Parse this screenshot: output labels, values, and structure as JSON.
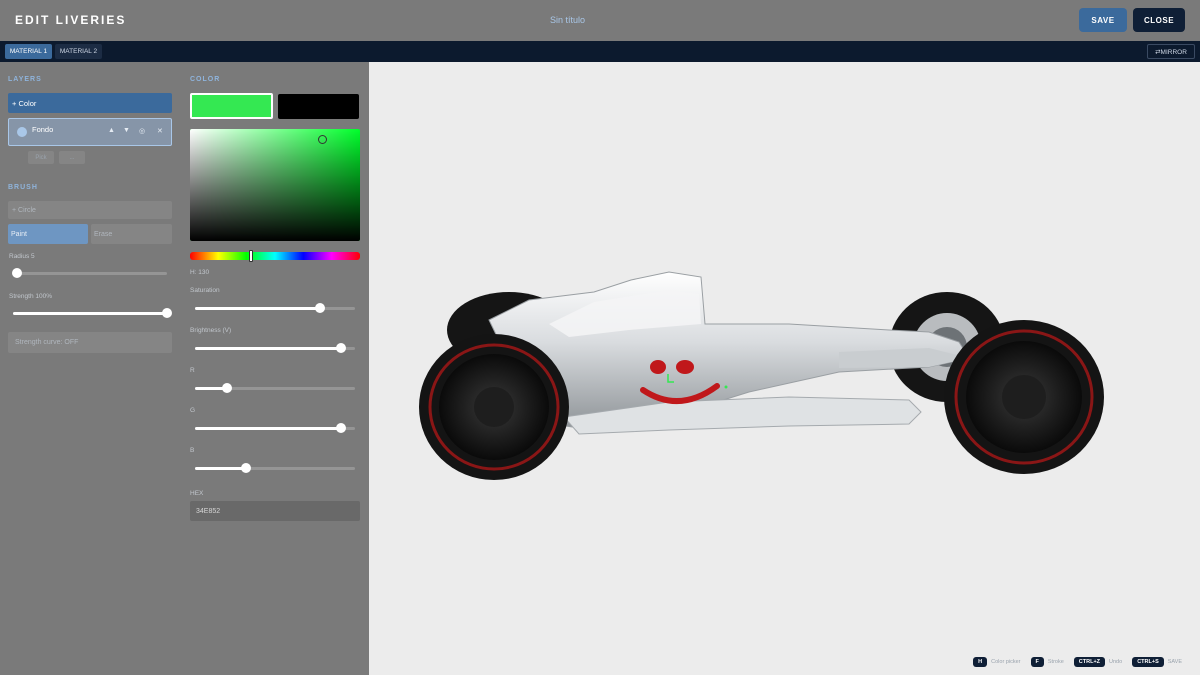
{
  "header": {
    "app_title": "EDIT LIVERIES",
    "doc_title": "Sin título",
    "save_label": "SAVE",
    "close_label": "CLOSE"
  },
  "materials": {
    "tabs": [
      {
        "label": "MATERIAL 1",
        "active": true
      },
      {
        "label": "MATERIAL 2",
        "active": false
      }
    ],
    "mirror_label": "⇄MIRROR"
  },
  "layers": {
    "section_label": "LAYERS",
    "add_color_label": "+ Color",
    "items": [
      {
        "name": "Fondo",
        "selected": true
      }
    ],
    "controls": {
      "up": "▲",
      "down": "▼",
      "visibility": "◎",
      "delete": "✕"
    },
    "actions": [
      "Pick",
      "..."
    ]
  },
  "brush": {
    "section_label": "BRUSH",
    "shape_label": "+ Circle",
    "mode_paint": "Paint",
    "mode_erase": "Erase",
    "active_mode": "Paint",
    "radius_label": "Radius 5",
    "radius_value": 0.0,
    "strength_label": "Strength 100%",
    "strength_value": 1.0,
    "strength_curve_label": "Strength curve: OFF"
  },
  "color": {
    "section_label": "COLOR",
    "primary_hex": "#34E852",
    "secondary_hex": "#000000",
    "hue_label": "H: 130",
    "hue_value": 130,
    "saturation_label": "Saturation",
    "saturation_value": 0.78,
    "brightness_label": "Brightness (V)",
    "brightness_value": 0.91,
    "r_label": "R",
    "r_value": 0.2,
    "g_label": "G",
    "g_value": 0.91,
    "b_label": "B",
    "b_value": 0.32,
    "hex_label": "HEX",
    "hex_value": "34E852"
  },
  "shortcuts": [
    {
      "key": "H",
      "label": "Color picker"
    },
    {
      "key": "F",
      "label": "Stroke"
    },
    {
      "key": "CTRL+Z",
      "label": "Undo"
    },
    {
      "key": "CTRL+S",
      "label": "SAVE"
    }
  ],
  "theme": {
    "accent": "#3b6a9c",
    "dark": "#0f1f36",
    "panel": "#7a7a7a",
    "viewport_bg": "#ececec",
    "livery_red": "#c0181b",
    "livery_green": "#34e852"
  }
}
